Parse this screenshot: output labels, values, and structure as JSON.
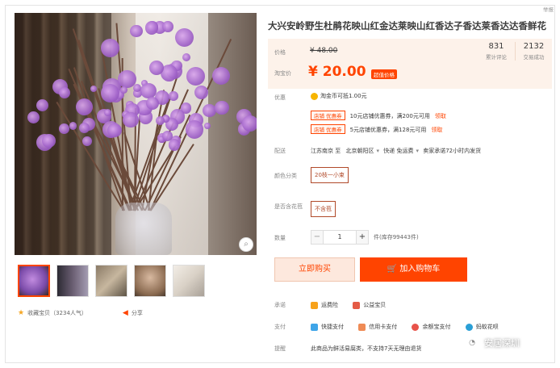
{
  "header": {
    "top_link": "举报"
  },
  "product": {
    "title": "大兴安岭野生杜鹃花映山红金达莱映山红香达子香达莱香达达香鲜花",
    "price_label": "价格",
    "original_price": "¥ 48.00",
    "taobao_price_label": "淘宝价",
    "current_price": "¥ 20.00",
    "price_tag": "超值价格",
    "stats": [
      {
        "num": "831",
        "caption": "累计评论"
      },
      {
        "num": "2132",
        "caption": "交易成功"
      }
    ]
  },
  "promo": {
    "label": "优惠",
    "coin_text": "淘金币可抵1.00元",
    "coupons": [
      {
        "badge": "店铺 优惠券",
        "text": "10元店铺优惠券，满200元可用",
        "link": "领取"
      },
      {
        "badge": "店铺 优惠券",
        "text": "5元店铺优惠券，满128元可用",
        "link": "领取"
      }
    ]
  },
  "delivery": {
    "label": "配送",
    "from": "江苏南京 至",
    "to": "北京朝阳区",
    "express": "快递 免运费",
    "promise": "卖家承诺72小时内发货"
  },
  "sku": {
    "color_label": "颜色分类",
    "color_value": "20枝一小束",
    "bloom_label": "是否含花苞",
    "bloom_value": "不含苞"
  },
  "quantity": {
    "label": "数量",
    "minus": "−",
    "value": "1",
    "plus": "+",
    "stock": "件(库存99443件)"
  },
  "actions": {
    "buy_now": "立即购买",
    "add_cart_icon": "cart-icon",
    "add_cart": "加入购物车"
  },
  "promise_row": {
    "label": "承诺",
    "items": [
      "运费险",
      "公益宝贝"
    ]
  },
  "pay_row": {
    "label": "支付",
    "items": [
      "快捷支付",
      "信用卡支付",
      "余额宝支付",
      "蚂蚁花呗"
    ]
  },
  "reminder_row": {
    "label": "提醒",
    "text": "此商品为鲜活易腐类，不支持7天无理由退货"
  },
  "gallery": {
    "favorite_text": "收藏宝贝（3234人气）",
    "share_text": "分享"
  },
  "watermark": {
    "text": "安居深圳"
  },
  "colors": {
    "accent": "#ff4400",
    "price_bg": "#fdf2ea",
    "sku_border": "#b14a2a"
  }
}
